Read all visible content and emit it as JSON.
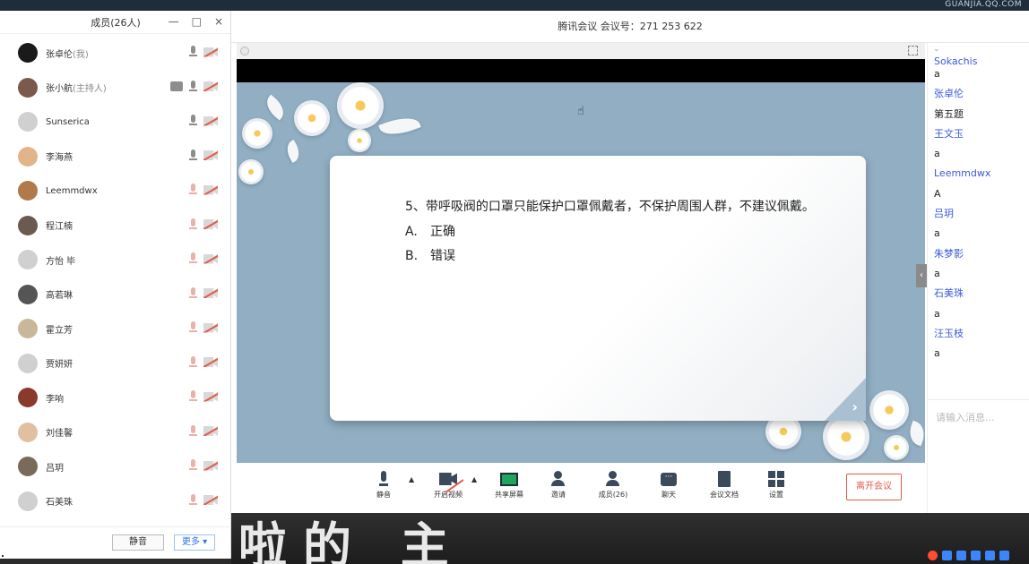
{
  "desktop": {
    "watermark": "GUANJIA.QQ.COM",
    "art_text": "啦的 主"
  },
  "members_panel": {
    "title": "成员(26人)",
    "window_buttons": [
      "—",
      "□",
      "×"
    ],
    "members": [
      {
        "name": "张卓伦",
        "role": "(我)",
        "avatar_color": "#1a1a1a",
        "screen": false,
        "mic": "on"
      },
      {
        "name": "张小航",
        "role": "(主持人)",
        "avatar_color": "#7a5a4a",
        "screen": true,
        "mic": "on"
      },
      {
        "name": "Sunserica",
        "role": "",
        "avatar_color": "#d0d0d0",
        "screen": false,
        "mic": "on"
      },
      {
        "name": "李海燕",
        "role": "",
        "avatar_color": "#e2b48a",
        "screen": false,
        "mic": "on"
      },
      {
        "name": "Leemmdwx",
        "role": "",
        "avatar_color": "#b07a4a",
        "screen": false,
        "mic": "off"
      },
      {
        "name": "程江楠",
        "role": "",
        "avatar_color": "#6a5a50",
        "screen": false,
        "mic": "off"
      },
      {
        "name": "方怡 毕",
        "role": "",
        "avatar_color": "#d0d0d0",
        "screen": false,
        "mic": "off"
      },
      {
        "name": "高若琳",
        "role": "",
        "avatar_color": "#555555",
        "screen": false,
        "mic": "off"
      },
      {
        "name": "霍立芳",
        "role": "",
        "avatar_color": "#c9b79a",
        "screen": false,
        "mic": "off"
      },
      {
        "name": "贾妍妍",
        "role": "",
        "avatar_color": "#d0d0d0",
        "screen": false,
        "mic": "off"
      },
      {
        "name": "李响",
        "role": "",
        "avatar_color": "#8a3a2a",
        "screen": false,
        "mic": "off"
      },
      {
        "name": "刘佳馨",
        "role": "",
        "avatar_color": "#e0c0a0",
        "screen": false,
        "mic": "off"
      },
      {
        "name": "吕玥",
        "role": "",
        "avatar_color": "#7a6a5a",
        "screen": false,
        "mic": "off"
      },
      {
        "name": "石美珠",
        "role": "",
        "avatar_color": "#d0d0d0",
        "screen": false,
        "mic": "off"
      }
    ],
    "mute_all_label": "静音",
    "more_label": "更多 ▾"
  },
  "main": {
    "window_title": "腾讯会议 会议号：271 253 622",
    "slide": {
      "question": "5、带呼吸阀的口罩只能保护口罩佩戴者，不保护周围人群，不建议佩戴。",
      "options": [
        {
          "key": "A.",
          "text": "正确"
        },
        {
          "key": "B.",
          "text": "错误"
        }
      ]
    },
    "toolbar": {
      "mute": "静音",
      "video": "开启视频",
      "share": "共享屏幕",
      "invite": "邀请",
      "members": "成员(26)",
      "chat": "聊天",
      "docs": "会议文档",
      "settings": "设置",
      "leave": "离开会议"
    }
  },
  "chat": {
    "cut_top": "Sokachis",
    "lines": [
      {
        "type": "t",
        "text": "a"
      },
      {
        "type": "n",
        "text": "张卓伦"
      },
      {
        "type": "t",
        "text": "第五题"
      },
      {
        "type": "n",
        "text": "王文玉"
      },
      {
        "type": "t",
        "text": "a"
      },
      {
        "type": "n",
        "text": "Leemmdwx"
      },
      {
        "type": "t",
        "text": "A"
      },
      {
        "type": "n",
        "text": "吕玥"
      },
      {
        "type": "t",
        "text": "a"
      },
      {
        "type": "n",
        "text": "朱梦影"
      },
      {
        "type": "t",
        "text": "a"
      },
      {
        "type": "n",
        "text": "石美珠"
      },
      {
        "type": "t",
        "text": "a"
      },
      {
        "type": "n",
        "text": "汪玉枝"
      },
      {
        "type": "t",
        "text": "a"
      }
    ],
    "input_placeholder": "请输入消息..."
  }
}
